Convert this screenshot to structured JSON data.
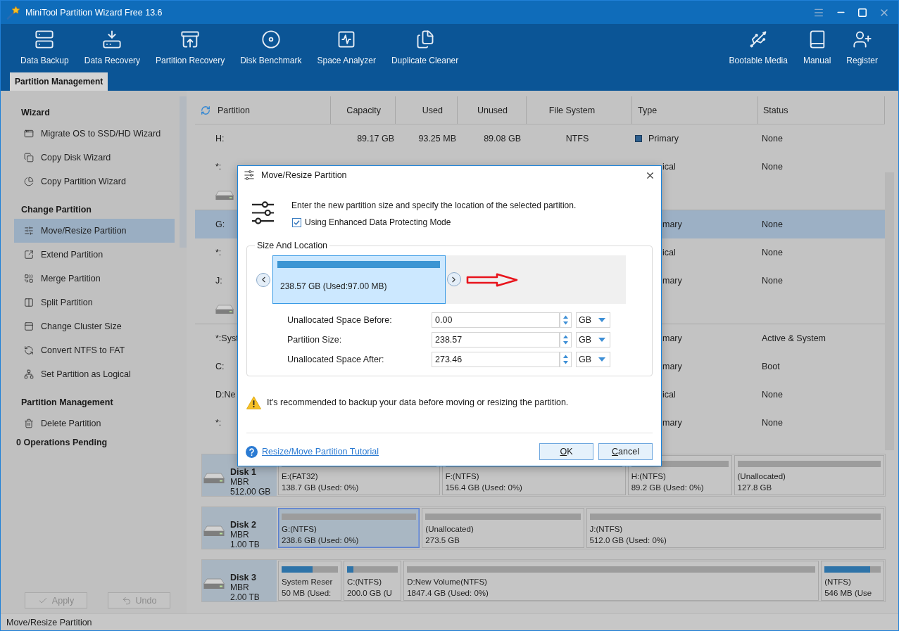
{
  "window": {
    "title": "MiniTool Partition Wizard Free 13.6"
  },
  "toolbar": {
    "left": [
      {
        "label": "Data Backup",
        "kind": "backup"
      },
      {
        "label": "Data Recovery",
        "kind": "recovery"
      },
      {
        "label": "Partition Recovery",
        "kind": "restore"
      },
      {
        "label": "Disk Benchmark",
        "kind": "benchmark"
      },
      {
        "label": "Space Analyzer",
        "kind": "analyzer"
      },
      {
        "label": "Duplicate Cleaner",
        "kind": "cleaner"
      }
    ],
    "right": [
      {
        "label": "Bootable Media",
        "kind": "media"
      },
      {
        "label": "Manual",
        "kind": "manual"
      },
      {
        "label": "Register",
        "kind": "register"
      }
    ]
  },
  "tabs": [
    {
      "label": "Partition Management",
      "selected": true
    }
  ],
  "sidebar": {
    "sections": [
      {
        "title": "Wizard",
        "items": [
          {
            "label": "Migrate OS to SSD/HD Wizard",
            "kind": "migrate",
            "selected": false
          },
          {
            "label": "Copy Disk Wizard",
            "kind": "copydisk",
            "selected": false
          },
          {
            "label": "Copy Partition Wizard",
            "kind": "copypartition",
            "selected": false
          }
        ]
      },
      {
        "title": "Change Partition",
        "items": [
          {
            "label": "Move/Resize Partition",
            "kind": "resize",
            "selected": true
          },
          {
            "label": "Extend Partition",
            "kind": "extend",
            "selected": false
          },
          {
            "label": "Merge Partition",
            "kind": "merge",
            "selected": false
          },
          {
            "label": "Split Partition",
            "kind": "split",
            "selected": false
          },
          {
            "label": "Change Cluster Size",
            "kind": "cluster",
            "selected": false
          },
          {
            "label": "Convert NTFS to FAT",
            "kind": "convert",
            "selected": false
          },
          {
            "label": "Set Partition as Logical",
            "kind": "logical",
            "selected": false
          }
        ]
      },
      {
        "title": "Partition Management",
        "items": [
          {
            "label": "Delete Partition",
            "kind": "delete",
            "selected": false
          }
        ]
      }
    ],
    "pending": "0 Operations Pending",
    "buttons": [
      {
        "label": "Apply",
        "kind": "apply",
        "disabled": true
      },
      {
        "label": "Undo",
        "kind": "undo",
        "disabled": true
      }
    ]
  },
  "table": {
    "columns": [
      "Partition",
      "Capacity",
      "Used",
      "Unused",
      "File System",
      "Type",
      "Status"
    ],
    "rows": [
      {
        "kind": "partition",
        "selected": false,
        "partition": "H:",
        "capacity": "89.17 GB",
        "used": "93.25 MB",
        "unused": "89.08 GB",
        "file_system": "NTFS",
        "type": "Primary",
        "status": "None"
      },
      {
        "kind": "partial",
        "selected": false,
        "partition": "*:",
        "type": "ical",
        "status": "None"
      },
      {
        "kind": "disk"
      },
      {
        "kind": "partial",
        "selected": true,
        "partition": "G:",
        "type": "mary",
        "status": "None"
      },
      {
        "kind": "partial",
        "selected": false,
        "partition": "*:",
        "type": "ical",
        "status": "None"
      },
      {
        "kind": "partial",
        "selected": false,
        "partition": "J:",
        "type": "mary",
        "status": "None"
      },
      {
        "kind": "disk"
      },
      {
        "kind": "partial",
        "selected": false,
        "partition": "*:Syst",
        "type": "mary",
        "status": "Active & System"
      },
      {
        "kind": "partial",
        "selected": false,
        "partition": "C:",
        "type": "mary",
        "status": "Boot"
      },
      {
        "kind": "partial",
        "selected": false,
        "partition": "D:Ne",
        "type": "ical",
        "status": "None"
      },
      {
        "kind": "partial",
        "selected": false,
        "partition": "*:",
        "type": "mary",
        "status": "None"
      }
    ]
  },
  "disk_map": {
    "disks": [
      {
        "name": "Disk 1",
        "scheme": "MBR",
        "size": "512.00 GB",
        "partitions": [
          {
            "name": "E:(FAT32)",
            "detail": "138.7 GB (Used: 0%)",
            "selected": false
          },
          {
            "name": "F:(NTFS)",
            "detail": "156.4 GB (Used: 0%)",
            "selected": false
          },
          {
            "name": "H:(NTFS)",
            "detail": "89.2 GB (Used: 0%)",
            "selected": false
          },
          {
            "name": "(Unallocated)",
            "detail": "127.8 GB",
            "selected": false
          }
        ]
      },
      {
        "name": "Disk 2",
        "scheme": "MBR",
        "size": "1.00 TB",
        "partitions": [
          {
            "name": "G:(NTFS)",
            "detail": "238.6 GB (Used: 0%)",
            "selected": true
          },
          {
            "name": "(Unallocated)",
            "detail": "273.5 GB",
            "selected": false
          },
          {
            "name": "J:(NTFS)",
            "detail": "512.0 GB (Used: 0%)",
            "selected": false
          }
        ]
      },
      {
        "name": "Disk 3",
        "scheme": "MBR",
        "size": "2.00 TB",
        "partitions": [
          {
            "name": "System Reser",
            "detail": "50 MB (Used:",
            "level": 0.55,
            "selected": false
          },
          {
            "name": "C:(NTFS)",
            "detail": "200.0 GB (U",
            "level": 0.12,
            "selected": false
          },
          {
            "name": "D:New Volume(NTFS)",
            "detail": "1847.4 GB (Used: 0%)",
            "selected": false
          },
          {
            "name": "(NTFS)",
            "detail": "546 MB (Use",
            "level": 0.81,
            "selected": false
          }
        ]
      }
    ]
  },
  "dialog": {
    "title": "Move/Resize Partition",
    "intro": "Enter the new partition size and specify the location of the selected partition.",
    "protect_mode": {
      "label": "Using Enhanced Data Protecting Mode",
      "checked": true
    },
    "group_title": "Size And Location",
    "partition": {
      "label": "238.57 GB (Used:97.00 MB)",
      "level": 0.49
    },
    "fields": [
      {
        "label": "Unallocated Space Before:",
        "value": "0.00",
        "unit": "GB"
      },
      {
        "label": "Partition Size:",
        "value": "238.57",
        "unit": "GB"
      },
      {
        "label": "Unallocated Space After:",
        "value": "273.46",
        "unit": "GB"
      }
    ],
    "warning": "It's recommended to backup your data before moving or resizing the partition.",
    "link": "Resize/Move Partition Tutorial",
    "buttons": [
      {
        "label": "OK"
      },
      {
        "label": "Cancel"
      }
    ]
  },
  "status_bar": {
    "text": "Move/Resize Partition"
  }
}
